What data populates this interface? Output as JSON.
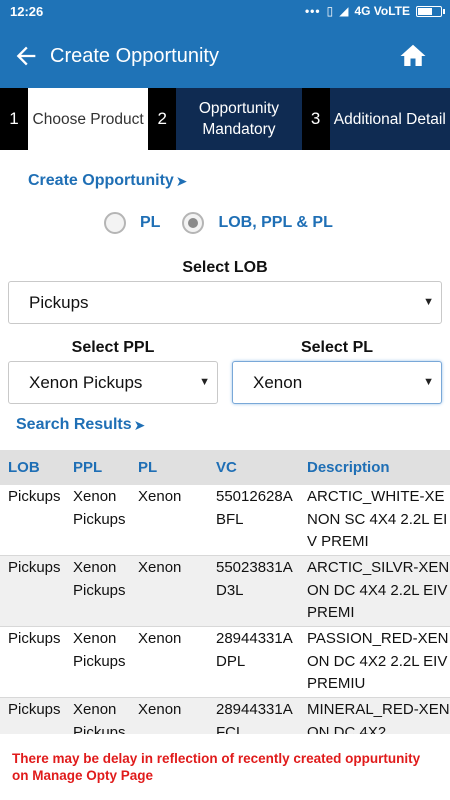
{
  "status_bar": {
    "time": "12:26",
    "network": "4G VoLTE"
  },
  "app_bar": {
    "title": "Create Opportunity"
  },
  "stepper": [
    {
      "num": "1",
      "label": "Choose Product"
    },
    {
      "num": "2",
      "label": "Opportunity Mandatory"
    },
    {
      "num": "3",
      "label": "Additional Detail"
    }
  ],
  "create_opportunity_link": "Create Opportunity",
  "radio": {
    "option1": "PL",
    "option2": "LOB, PPL & PL",
    "selected": "LOB, PPL & PL"
  },
  "lob": {
    "label": "Select LOB",
    "value": "Pickups"
  },
  "ppl": {
    "label": "Select PPL",
    "value": "Xenon Pickups"
  },
  "pl": {
    "label": "Select PL",
    "value": "Xenon"
  },
  "search_results_link": "Search Results",
  "table": {
    "headers": {
      "lob": "LOB",
      "ppl": "PPL",
      "pl": "PL",
      "vc": "VC",
      "desc": "Description"
    },
    "rows": [
      {
        "lob": "Pickups",
        "ppl": "Xenon Pickups",
        "pl": "Xenon",
        "vc": "55012628ABFL",
        "desc": "ARCTIC_WHITE-XENON SC 4X4 2.2L EIV PREMI"
      },
      {
        "lob": "Pickups",
        "ppl": "Xenon Pickups",
        "pl": "Xenon",
        "vc": "55023831AD3L",
        "desc": "ARCTIC_SILVR-XENON DC 4X4 2.2L EIV PREMI"
      },
      {
        "lob": "Pickups",
        "ppl": "Xenon Pickups",
        "pl": "Xenon",
        "vc": "28944331ADPL",
        "desc": "PASSION_RED-XENON DC 4X2 2.2L EIV PREMIU"
      },
      {
        "lob": "Pickups",
        "ppl": "Xenon Pickups",
        "pl": "Xenon",
        "vc": "28944331AFCL",
        "desc": "MINERAL_RED-XENON DC 4X2"
      }
    ]
  },
  "notice": "There may be delay in reflection of recently created oppurtunity on Manage Opty Page"
}
